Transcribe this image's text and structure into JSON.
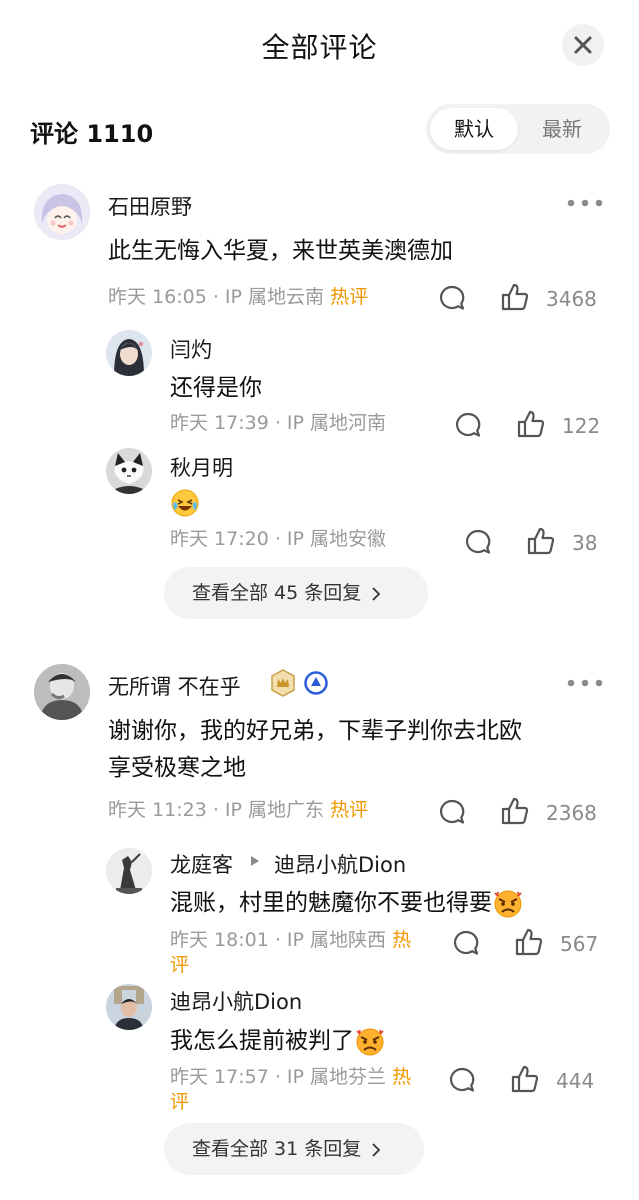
{
  "header": {
    "title": "全部评论"
  },
  "summary": {
    "label": "评论 1110"
  },
  "sort": {
    "default": "默认",
    "latest": "最新"
  },
  "comments": [
    {
      "name": "石田原野",
      "text": "此生无悔入华夏，来世英美澳德加",
      "time": "昨天 16:05",
      "location": "· IP 属地云南",
      "hot": "热评",
      "likes": "3468",
      "replies": [
        {
          "name": "闫灼",
          "text": "还得是你",
          "time": "昨天 17:39",
          "location": "· IP 属地河南",
          "likes": "122"
        },
        {
          "name": "秋月明",
          "text": "",
          "time": "昨天 17:20",
          "location": "· IP 属地安徽",
          "likes": "38",
          "emoji": "laughing-crying-emoji"
        }
      ],
      "view_all": "查看全部 45 条回复"
    },
    {
      "name": "无所谓 不在乎",
      "text_line1": "谢谢你，我的好兄弟，下辈子判你去北欧",
      "text_line2": "享受极寒之地",
      "time": "昨天 11:23",
      "location": "· IP 属地广东",
      "hot": "热评",
      "likes": "2368",
      "replies": [
        {
          "name": "龙庭客",
          "reply_to": "迪昂小航Dion",
          "text": "混账，村里的魅魔你不要也得要",
          "time": "昨天 18:01",
          "location": "· IP 属地陕西",
          "hot_1": "热",
          "hot_2": "评",
          "likes": "567"
        },
        {
          "name": "迪昂小航Dion",
          "text": "我怎么提前被判了",
          "time": "昨天 17:57",
          "location": "· IP 属地芬兰",
          "hot_1": "热",
          "hot_2": "评",
          "likes": "444"
        }
      ],
      "view_all": "查看全部 31 条回复"
    }
  ],
  "colors": {
    "hot": "#f39800",
    "muted": "#9a9a9a",
    "pill_bg": "#f3f3f3"
  }
}
